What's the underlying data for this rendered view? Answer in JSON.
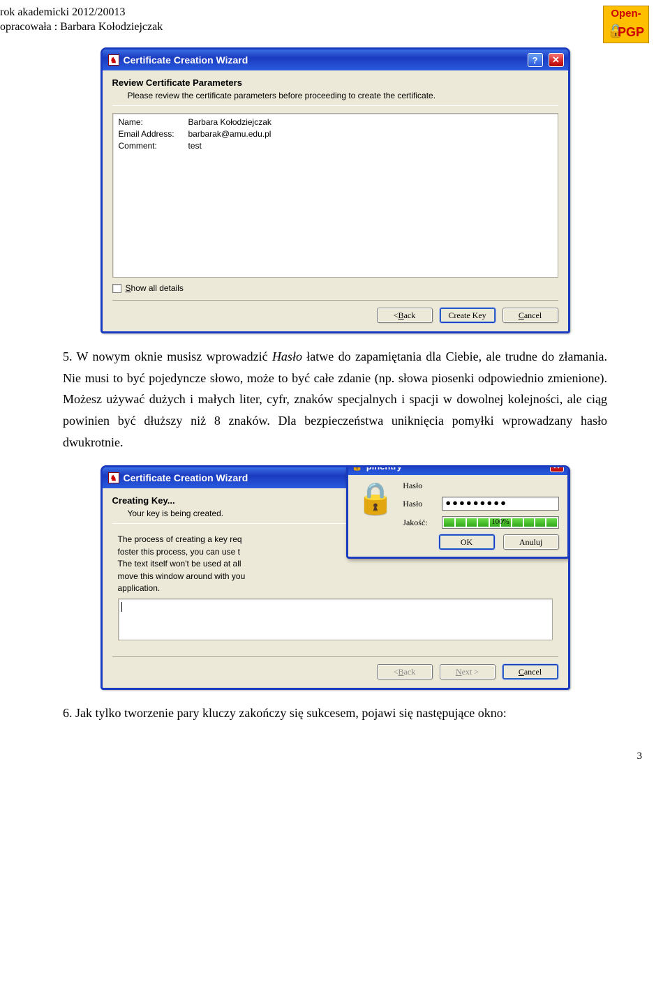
{
  "header": {
    "line1": "rok akademicki 2012/20013",
    "line2": "opracowała : Barbara Kołodziejczak",
    "logo_open": "Open-",
    "logo_pgp": "PGP"
  },
  "para5": {
    "num": "5.",
    "text_a": "W nowym oknie musisz wprowadzić ",
    "italic": "Hasło",
    "text_b": " łatwe do zapamiętania dla Ciebie, ale trudne do złamania. Nie musi to być pojedyncze słowo, może to być całe zdanie (np. słowa piosenki odpowiednio zmienione). Możesz używać dużych i małych liter, cyfr, znaków specjalnych i spacji w dowolnej kolejności, ale ciąg powinien być dłuższy niż 8 znaków. Dla bezpieczeństwa uniknięcia pomyłki wprowadzany hasło dwukrotnie."
  },
  "para6": {
    "num": "6.",
    "text": "Jak tylko tworzenie pary kluczy zakończy się sukcesem, pojawi się następujące okno:"
  },
  "dialog1": {
    "title": "Certificate Creation Wizard",
    "section_title": "Review Certificate Parameters",
    "section_sub": "Please review the certificate parameters before proceeding to create the certificate.",
    "rows": [
      {
        "label": "Name:",
        "value": "Barbara Kołodziejczak"
      },
      {
        "label": "Email Address:",
        "value": "barbarak@amu.edu.pl"
      },
      {
        "label": "Comment:",
        "value": "test"
      }
    ],
    "show_all": "Show all details",
    "back": "< Back",
    "create": "Create Key",
    "cancel": "Cancel"
  },
  "dialog2": {
    "title": "Certificate Creation Wizard",
    "section_title": "Creating Key...",
    "section_sub": "Your key is being created.",
    "body1": "The process of creating a key requires large amounts of random numbers. To foster this process, you can use the entry field below to enter some gibberish. The text itself won't be used at all, it will only be used to foster the randomness. You can also move this window around with your mouse, or start other disk intensive application.",
    "back": "< Back",
    "next": "Next >",
    "cancel": "Cancel"
  },
  "pinentry": {
    "title": "pinentry",
    "label_top": "Hasło",
    "label_pw": "Hasło",
    "label_quality": "Jakość:",
    "password_mask": "●●●●●●●●●",
    "quality_pct": "100%",
    "ok": "OK",
    "cancel": "Anuluj"
  },
  "page_number": "3"
}
